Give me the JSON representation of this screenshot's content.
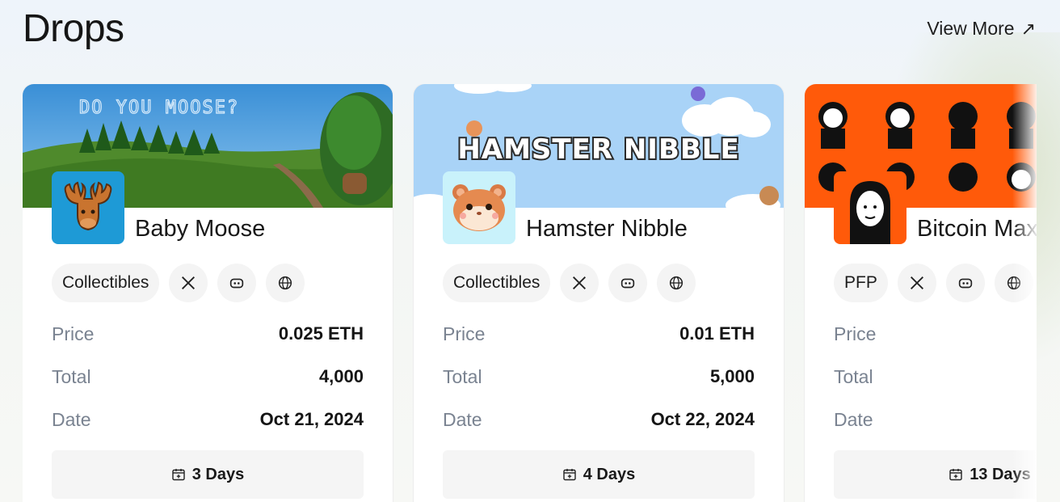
{
  "header": {
    "title": "Drops",
    "view_more": "View More",
    "view_more_icon": "arrow-up-right-icon"
  },
  "colors": {
    "card_bg": "#ffffff",
    "chip_bg": "#f4f4f4",
    "label_gray": "#7a8391",
    "bitcoin_orange": "#ff5a0a",
    "hamster_sky": "#a9d3f7"
  },
  "cards": [
    {
      "name": "Baby Moose",
      "banner_text": "DO YOU MOOSE?",
      "category": "Collectibles",
      "price_label": "Price",
      "price": "0.025 ETH",
      "total_label": "Total",
      "total": "4,000",
      "date_label": "Date",
      "date": "Oct 21, 2024",
      "days": "3 Days"
    },
    {
      "name": "Hamster Nibble",
      "banner_text": "HAMSTER NIBBLE",
      "category": "Collectibles",
      "price_label": "Price",
      "price": "0.01 ETH",
      "total_label": "Total",
      "total": "5,000",
      "date_label": "Date",
      "date": "Oct 22, 2024",
      "days": "4 Days"
    },
    {
      "name": "Bitcoin Max",
      "category": "PFP",
      "price_label": "Price",
      "price": "(",
      "total_label": "Total",
      "total": "",
      "date_label": "Date",
      "date": "",
      "days": "13 Days"
    }
  ]
}
